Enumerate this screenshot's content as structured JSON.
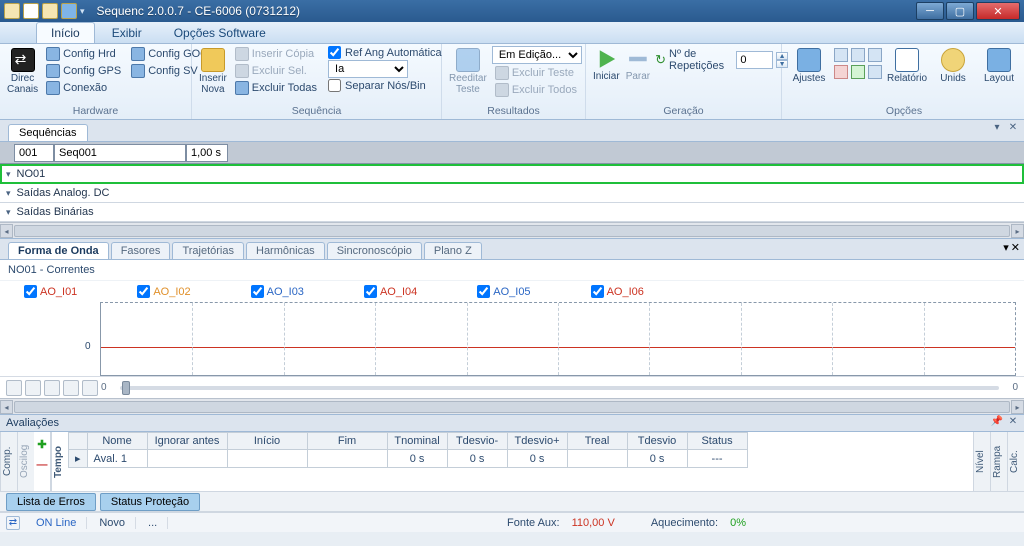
{
  "app": {
    "title": "Sequenc 2.0.0.7 - CE-6006 (0731212)",
    "tabs": {
      "inicio": "Início",
      "exibir": "Exibir",
      "opcoes": "Opções Software"
    }
  },
  "ribbon": {
    "hardware": {
      "label": "Hardware",
      "direc_canais": "Direc Canais",
      "config_hrd": "Config Hrd",
      "config_gps": "Config GPS",
      "conexao": "Conexão",
      "config_goose": "Config GOOSE",
      "config_sv": "Config SV"
    },
    "sequencia": {
      "label": "Sequência",
      "inserir_nova": "Inserir Nova",
      "inserir_copia": "Inserir Cópia",
      "excluir_sel": "Excluir Sel.",
      "excluir_todas": "Excluir Todas",
      "ref_ang_auto": "Ref Ang Automática",
      "ia_option": "Ia",
      "separar_nos": "Separar Nós/Bin"
    },
    "resultados": {
      "label": "Resultados",
      "reeditar_teste": "Reeditar Teste",
      "em_edicao": "Em Edição...",
      "excluir_teste": "Excluir Teste",
      "excluir_todos": "Excluir Todos"
    },
    "geracao": {
      "label": "Geração",
      "iniciar": "Iniciar",
      "parar": "Parar",
      "n_repeticoes": "Nº de Repetições",
      "n_repeticoes_val": "0"
    },
    "opcoes": {
      "label": "Opções",
      "ajustes": "Ajustes",
      "relatorio": "Relatório",
      "unids": "Unids",
      "layout": "Layout"
    }
  },
  "seqpanel": {
    "tab": "Sequências",
    "idx": "001",
    "name": "Seq001",
    "duration": "1,00 s"
  },
  "accordion": {
    "no01": "NO01",
    "saidas_analog": "Saídas Analog. DC",
    "saidas_bin": "Saídas Binárias"
  },
  "wave": {
    "tabs": {
      "forma": "Forma de Onda",
      "fasores": "Fasores",
      "trajetorias": "Trajetórias",
      "harmonicas": "Harmônicas",
      "sincro": "Sincronoscópio",
      "planoz": "Plano Z"
    },
    "hdr": "NO01 - Correntes",
    "channels": [
      "AO_I01",
      "AO_I02",
      "AO_I03",
      "AO_I04",
      "AO_I05",
      "AO_I06"
    ],
    "zero": "0"
  },
  "aval": {
    "title": "Avaliações",
    "sidetabs": {
      "comp": "Comp.",
      "oscilog": "Oscilog",
      "tempo": "Tempo",
      "nivel": "Nível",
      "rampa": "Rampa",
      "calc": "Calc."
    },
    "cols": [
      "Nome",
      "Ignorar antes",
      "Início",
      "Fim",
      "Tnominal",
      "Tdesvio-",
      "Tdesvio+",
      "Treal",
      "Tdesvio",
      "Status"
    ],
    "row1": {
      "nome": "Aval. 1",
      "tnominal": "0 s",
      "tdesvio_m": "0 s",
      "tdesvio_p": "0 s",
      "tdesvio": "0 s",
      "status": "---"
    }
  },
  "bottom_tabs": {
    "erros": "Lista de Erros",
    "status_prot": "Status Proteção"
  },
  "status": {
    "online": "ON Line",
    "novo": "Novo",
    "dots": "...",
    "fonte_aux_lbl": "Fonte Aux:",
    "fonte_aux_val": "110,00 V",
    "aquec_lbl": "Aquecimento:",
    "aquec_val": "0%"
  }
}
